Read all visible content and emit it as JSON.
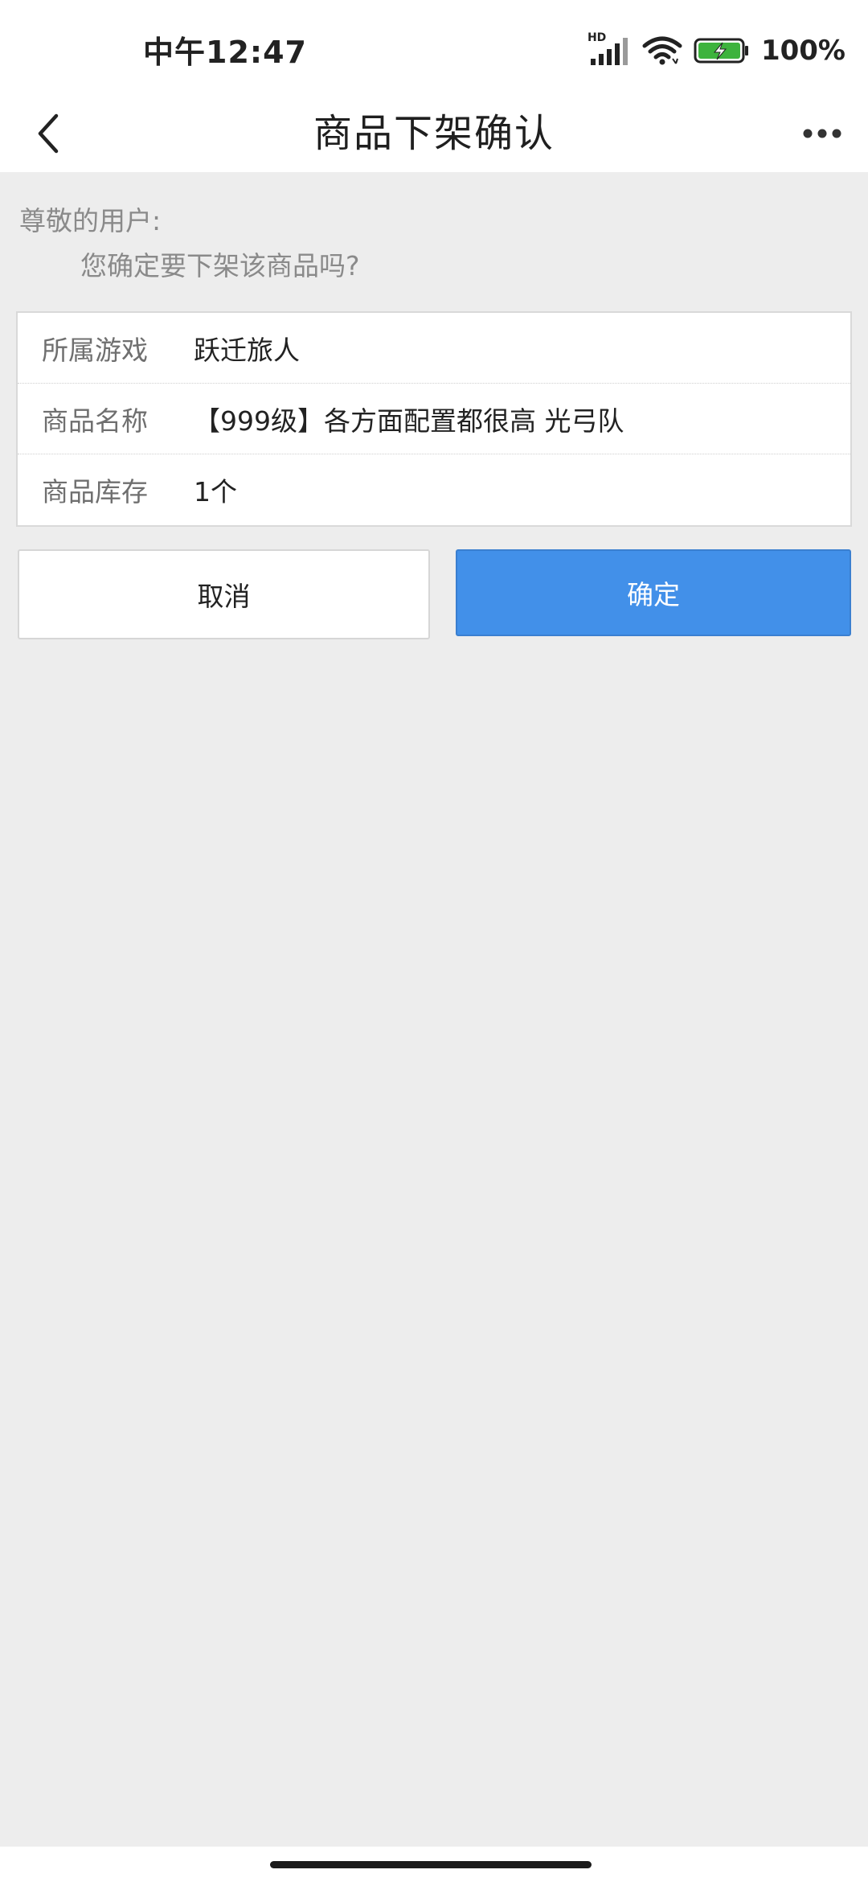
{
  "status_bar": {
    "time": "中午12:47",
    "network_label": "HD",
    "battery_percent": "100%",
    "battery_level": 1.0,
    "battery_color": "#3db33d"
  },
  "nav": {
    "title": "商品下架确认",
    "back_icon": "chevron-left-icon",
    "more_icon": "more-horizontal-icon"
  },
  "message": {
    "greeting": "尊敬的用户:",
    "question": "您确定要下架该商品吗?"
  },
  "info": {
    "rows": [
      {
        "label": "所属游戏",
        "value": "跃迁旅人"
      },
      {
        "label": "商品名称",
        "value": "【999级】各方面配置都很高 光弓队"
      },
      {
        "label": "商品库存",
        "value": "1个"
      }
    ]
  },
  "actions": {
    "cancel_label": "取消",
    "confirm_label": "确定",
    "confirm_color": "#4290e9"
  }
}
